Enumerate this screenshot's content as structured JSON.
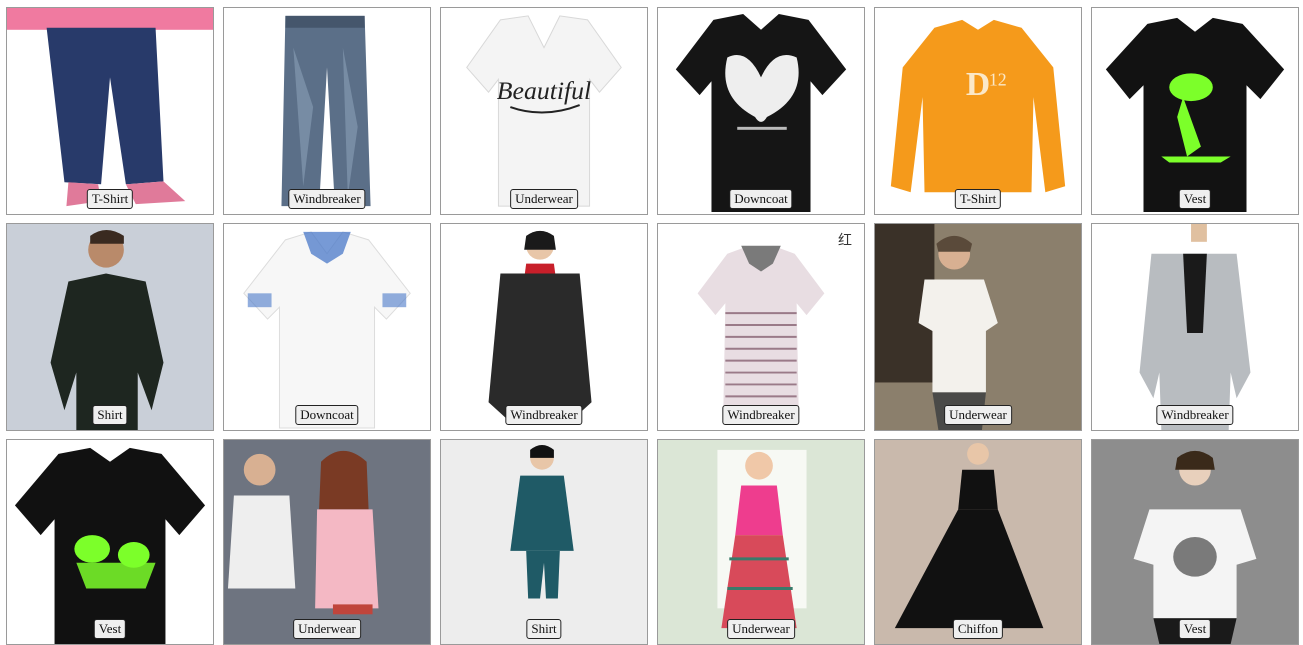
{
  "gallery": {
    "items": [
      {
        "label": "T-Shirt",
        "icon": "jeans-photo-icon"
      },
      {
        "label": "Windbreaker",
        "icon": "jeans-photo-icon"
      },
      {
        "label": "Underwear",
        "icon": "white-tshirt-photo-icon",
        "print": "Beautiful"
      },
      {
        "label": "Downcoat",
        "icon": "black-tshirt-photo-icon"
      },
      {
        "label": "T-Shirt",
        "icon": "orange-sweatshirt-photo-icon"
      },
      {
        "label": "Vest",
        "icon": "black-tshirt-photo-icon"
      },
      {
        "label": "Shirt",
        "icon": "man-long-sleeve-photo-icon"
      },
      {
        "label": "Downcoat",
        "icon": "white-polo-photo-icon"
      },
      {
        "label": "Windbreaker",
        "icon": "woman-coat-photo-icon"
      },
      {
        "label": "Windbreaker",
        "icon": "striped-polo-photo-icon",
        "corner_text": "红"
      },
      {
        "label": "Underwear",
        "icon": "man-tshirt-photo-icon"
      },
      {
        "label": "Windbreaker",
        "icon": "man-blazer-photo-icon"
      },
      {
        "label": "Vest",
        "icon": "black-tshirt-photo-icon"
      },
      {
        "label": "Underwear",
        "icon": "couple-photo-icon"
      },
      {
        "label": "Shirt",
        "icon": "woman-teal-top-photo-icon"
      },
      {
        "label": "Underwear",
        "icon": "woman-pink-dress-photo-icon"
      },
      {
        "label": "Chiffon",
        "icon": "black-dress-photo-icon"
      },
      {
        "label": "Vest",
        "icon": "woman-white-tshirt-photo-icon"
      }
    ]
  }
}
